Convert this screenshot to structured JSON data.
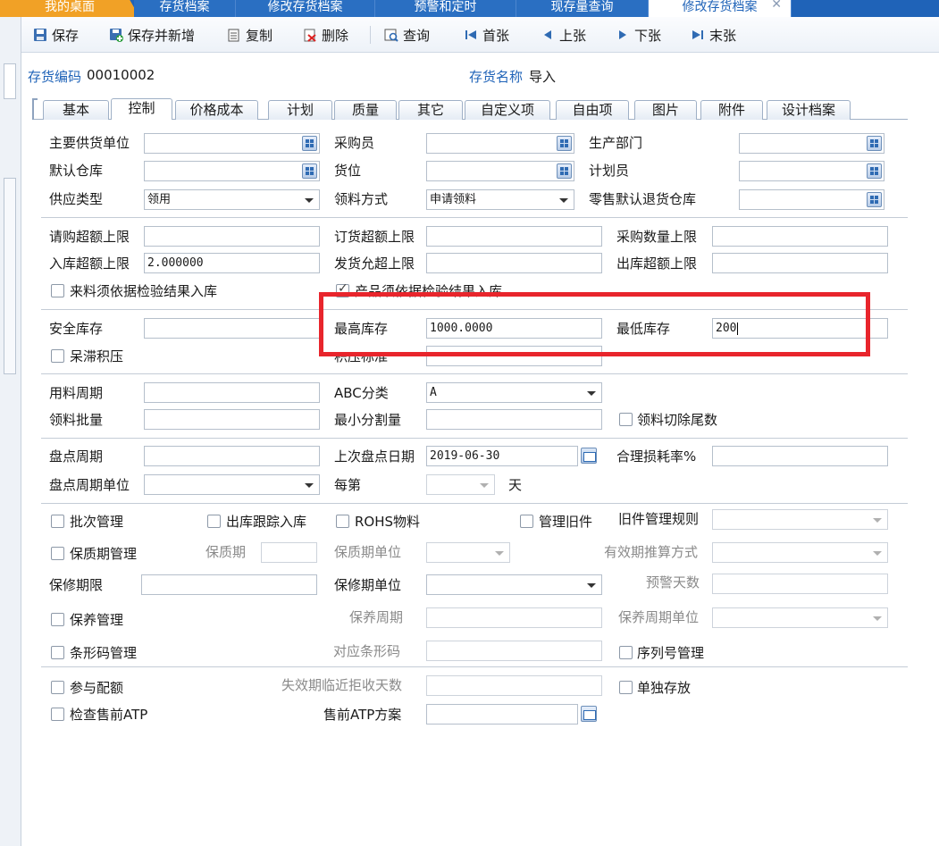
{
  "top_tabs": [
    "我的桌面",
    "存货档案",
    "修改存货档案",
    "预警和定时",
    "现存量查询",
    "修改存货档案"
  ],
  "toolbar": {
    "save": "保存",
    "save_new": "保存并新增",
    "copy": "复制",
    "delete": "删除",
    "query": "查询",
    "first": "首张",
    "prev": "上张",
    "next": "下张",
    "last": "末张"
  },
  "header": {
    "code_label": "存货编码",
    "code_value": "00010002",
    "name_label": "存货名称",
    "name_value": "导入"
  },
  "subtabs": [
    "基本",
    "控制",
    "价格成本",
    "计划",
    "质量",
    "其它",
    "自定义项",
    "自由项",
    "图片",
    "附件",
    "设计档案"
  ],
  "active_subtab": "控制",
  "form": {
    "main_supplier": "主要供货单位",
    "purchaser": "采购员",
    "prod_dept": "生产部门",
    "default_wh": "默认仓库",
    "location": "货位",
    "planner": "计划员",
    "supply_type": "供应类型",
    "supply_type_value": "领用",
    "pick_method": "领料方式",
    "pick_method_value": "申请领料",
    "retail_return_wh": "零售默认退货仓库",
    "req_over_limit": "请购超额上限",
    "order_over_limit": "订货超额上限",
    "purchase_qty_limit": "采购数量上限",
    "in_over_limit": "入库超额上限",
    "in_over_limit_value": "2.000000",
    "ship_over_limit": "发货允超上限",
    "out_over_limit": "出库超额上限",
    "incoming_by_inspection": "来料须依据检验结果入库",
    "product_by_inspection": "产品须依据检验结果入库",
    "safety_stock": "安全库存",
    "max_stock": "最高库存",
    "max_stock_value": "1000.0000",
    "min_stock": "最低库存",
    "min_stock_value": "200",
    "stagnant": "呆滞积压",
    "reorder_point": "积压标准",
    "usage_cycle": "用料周期",
    "abc_class": "ABC分类",
    "abc_value": "A",
    "pick_batch": "领料批量",
    "min_split": "最小分割量",
    "pick_cut_tail": "领料切除尾数",
    "count_cycle": "盘点周期",
    "last_count_date": "上次盘点日期",
    "last_count_date_value": "2019-06-30",
    "loss_rate": "合理损耗率%",
    "count_cycle_unit": "盘点周期单位",
    "every": "每第",
    "day": "天",
    "batch_mgmt": "批次管理",
    "out_tracking": "出库跟踪入库",
    "rohs": "ROHS物料",
    "old_parts": "管理旧件",
    "old_parts_rule": "旧件管理规则",
    "shelf_life_mgmt": "保质期管理",
    "shelf_life": "保质期",
    "shelf_life_unit": "保质期单位",
    "expiry_calc": "有效期推算方式",
    "warranty": "保修期限",
    "warranty_unit": "保修期单位",
    "warning_days": "预警天数",
    "maintenance_mgmt": "保养管理",
    "maintenance_cycle": "保养周期",
    "maintenance_cycle_unit": "保养周期单位",
    "barcode_mgmt": "条形码管理",
    "barcode": "对应条形码",
    "serial_mgmt": "序列号管理",
    "allocation": "参与配额",
    "expiry_reject_days": "失效期临近拒收天数",
    "separate_storage": "单独存放",
    "atp_check": "检查售前ATP",
    "atp_plan": "售前ATP方案"
  },
  "highlight_color": "#e8252c"
}
